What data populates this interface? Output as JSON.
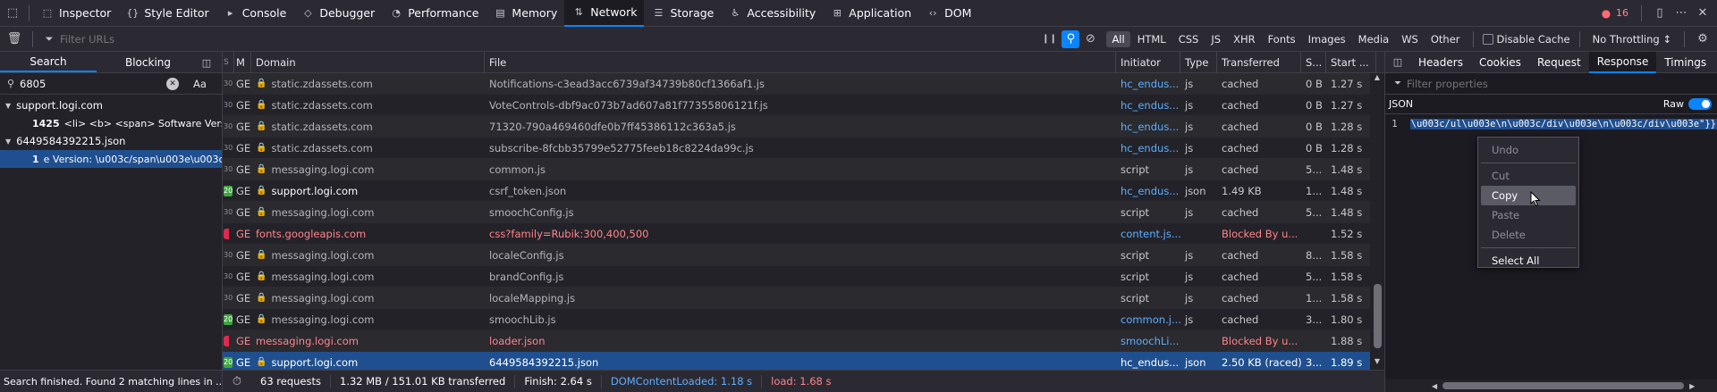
{
  "toolbar": {
    "tabs": [
      {
        "label": "Inspector",
        "icon": "inspector-icon"
      },
      {
        "label": "Style Editor",
        "icon": "style-editor-icon"
      },
      {
        "label": "Console",
        "icon": "console-icon"
      },
      {
        "label": "Debugger",
        "icon": "debugger-icon"
      },
      {
        "label": "Performance",
        "icon": "performance-icon"
      },
      {
        "label": "Memory",
        "icon": "memory-icon"
      },
      {
        "label": "Network",
        "icon": "network-icon",
        "active": true
      },
      {
        "label": "Storage",
        "icon": "storage-icon"
      },
      {
        "label": "Accessibility",
        "icon": "accessibility-icon"
      },
      {
        "label": "Application",
        "icon": "application-icon"
      },
      {
        "label": "DOM",
        "icon": "dom-icon"
      }
    ],
    "error_count": "16"
  },
  "filterbar": {
    "placeholder": "Filter URLs",
    "types": [
      "All",
      "HTML",
      "CSS",
      "JS",
      "XHR",
      "Fonts",
      "Images",
      "Media",
      "WS",
      "Other"
    ],
    "active_type": "All",
    "disable_cache": "Disable Cache",
    "throttling": "No Throttling ↕"
  },
  "search": {
    "tabs": [
      "Search",
      "Blocking"
    ],
    "query": "6805",
    "case_label": "Aa",
    "results": [
      {
        "file": "support.logi.com",
        "lines": [
          {
            "num": "1425",
            "text": "<li> <b> <span> Software Version:..."
          }
        ]
      },
      {
        "file": "6449584392215.json",
        "lines": [
          {
            "num": "1",
            "text": "e Version: \\u003c/span\\u003e\\u003c/b..."
          }
        ]
      }
    ],
    "status": "Search finished. Found 2 matching lines in ..."
  },
  "table": {
    "columns": [
      "S",
      "M",
      "Domain",
      "File",
      "Initiator",
      "Type",
      "Transferred",
      "S...",
      "Start ..."
    ],
    "rows": [
      {
        "status": "30",
        "method": "GE",
        "domain": "static.zdassets.com",
        "file": "Notifications-c3ead3acc6739af34739b80cf1366af1.js",
        "initiator": "hc_endus...",
        "type": "js",
        "transferred": "cached",
        "size": "0 B",
        "start": "1.27 s",
        "lock": true
      },
      {
        "status": "30",
        "method": "GE",
        "domain": "static.zdassets.com",
        "file": "VoteControls-dbf9ac073b7ad607a81f77355806121f.js",
        "initiator": "hc_endus...",
        "type": "js",
        "transferred": "cached",
        "size": "0 B",
        "start": "1.27 s",
        "lock": true
      },
      {
        "status": "30",
        "method": "GE",
        "domain": "static.zdassets.com",
        "file": "71320-790a469460dfe0b7ff45386112c363a5.js",
        "initiator": "hc_endus...",
        "type": "js",
        "transferred": "cached",
        "size": "0 B",
        "start": "1.28 s",
        "lock": true
      },
      {
        "status": "30",
        "method": "GE",
        "domain": "static.zdassets.com",
        "file": "subscribe-8fcbb35799e52775feeb18c8224da99c.js",
        "initiator": "hc_endus...",
        "type": "js",
        "transferred": "cached",
        "size": "0 B",
        "start": "1.28 s",
        "lock": true
      },
      {
        "status": "30",
        "method": "GE",
        "domain": "messaging.logi.com",
        "file": "common.js",
        "initiator": "script",
        "type": "js",
        "transferred": "cached",
        "size": "5...",
        "start": "1.48 s",
        "lock": true
      },
      {
        "status": "20",
        "method": "GE",
        "domain": "support.logi.com",
        "file": "csrf_token.json",
        "initiator": "hc_endus...",
        "type": "json",
        "transferred": "1.49 KB",
        "size": "1...",
        "start": "1.48 s",
        "lock": true,
        "ok": true
      },
      {
        "status": "30",
        "method": "GE",
        "domain": "messaging.logi.com",
        "file": "smoochConfig.js",
        "initiator": "script",
        "type": "js",
        "transferred": "cached",
        "size": "5...",
        "start": "1.48 s",
        "lock": true
      },
      {
        "status": "",
        "method": "GE",
        "domain": "fonts.googleapis.com",
        "file": "css?family=Rubik:300,400,500",
        "initiator": "content.js...",
        "type": "",
        "transferred": "Blocked By u...",
        "size": "",
        "start": "1.52 s",
        "lock": false,
        "error": true
      },
      {
        "status": "30",
        "method": "GE",
        "domain": "messaging.logi.com",
        "file": "localeConfig.js",
        "initiator": "script",
        "type": "js",
        "transferred": "cached",
        "size": "8...",
        "start": "1.58 s",
        "lock": true
      },
      {
        "status": "30",
        "method": "GE",
        "domain": "messaging.logi.com",
        "file": "brandConfig.js",
        "initiator": "script",
        "type": "js",
        "transferred": "cached",
        "size": "5...",
        "start": "1.58 s",
        "lock": true
      },
      {
        "status": "30",
        "method": "GE",
        "domain": "messaging.logi.com",
        "file": "localeMapping.js",
        "initiator": "script",
        "type": "js",
        "transferred": "cached",
        "size": "1...",
        "start": "1.58 s",
        "lock": true
      },
      {
        "status": "20",
        "method": "GE",
        "domain": "messaging.logi.com",
        "file": "smoochLib.js",
        "initiator": "common.j...",
        "type": "js",
        "transferred": "cached",
        "size": "3...",
        "start": "1.80 s",
        "lock": true,
        "ok": true
      },
      {
        "status": "",
        "method": "GE",
        "domain": "messaging.logi.com",
        "file": "loader.json",
        "initiator": "smoochLi...",
        "type": "",
        "transferred": "Blocked By u...",
        "size": "",
        "start": "1.88 s",
        "lock": false,
        "error": true
      },
      {
        "status": "20",
        "method": "GE",
        "domain": "support.logi.com",
        "file": "6449584392215.json",
        "initiator": "hc_endus...",
        "type": "json",
        "transferred": "2.50 KB (raced)",
        "size": "3...",
        "start": "1.89 s",
        "lock": true,
        "ok": true,
        "selected": true
      }
    ]
  },
  "statusbar": {
    "requests": "63 requests",
    "transferred": "1.32 MB / 151.01 KB transferred",
    "finish": "Finish: 2.64 s",
    "domcontentloaded": "DOMContentLoaded: 1.18 s",
    "load": "load: 1.68 s"
  },
  "details": {
    "tabs": [
      "Headers",
      "Cookies",
      "Request",
      "Response",
      "Timings"
    ],
    "active_tab": "Response",
    "filter_placeholder": "Filter properties",
    "section": "JSON",
    "raw_label": "Raw",
    "line_number": "1",
    "line_text": "\\u003c/ul\\u003e\\n\\u003c/div\\u003e\\n\\u003c/div\\u003e\"}}"
  },
  "context_menu": {
    "items": [
      {
        "label": "Undo",
        "disabled": true
      },
      {
        "sep": true
      },
      {
        "label": "Cut",
        "disabled": true
      },
      {
        "label": "Copy",
        "disabled": false,
        "highlighted": true
      },
      {
        "label": "Paste",
        "disabled": true
      },
      {
        "label": "Delete",
        "disabled": true
      },
      {
        "sep": true
      },
      {
        "label": "Select All",
        "disabled": false
      }
    ]
  },
  "colors": {
    "accent": "#0a84ff",
    "error": "#ff848b",
    "link": "#5eaeff",
    "selected_row": "#1f4f8f",
    "ok_badge": "#3fa63f",
    "err_badge": "#e22850",
    "redir_badge": "#4a4a55"
  }
}
